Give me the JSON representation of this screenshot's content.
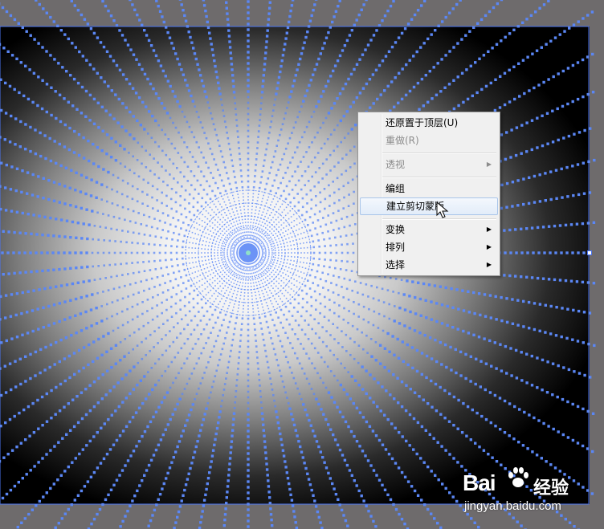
{
  "app": {
    "canvas_background": "#6e6b6c",
    "selection_color": "#4b74f0",
    "ray_color": "#5b87f5"
  },
  "context_menu": {
    "items": [
      {
        "label": "还原置于顶层(U)",
        "enabled": true,
        "submenu": false,
        "highlighted": false
      },
      {
        "label": "重做(R)",
        "enabled": false,
        "submenu": false,
        "highlighted": false
      },
      {
        "separator": true
      },
      {
        "label": "透视",
        "enabled": false,
        "submenu": true,
        "highlighted": false
      },
      {
        "separator": true
      },
      {
        "label": "编组",
        "enabled": true,
        "submenu": false,
        "highlighted": false
      },
      {
        "label": "建立剪切蒙版",
        "enabled": true,
        "submenu": false,
        "highlighted": true
      },
      {
        "separator": true
      },
      {
        "label": "变换",
        "enabled": true,
        "submenu": true,
        "highlighted": false
      },
      {
        "label": "排列",
        "enabled": true,
        "submenu": true,
        "highlighted": false
      },
      {
        "label": "选择",
        "enabled": true,
        "submenu": true,
        "highlighted": false
      }
    ],
    "submenu_arrow": "▶"
  },
  "watermark": {
    "logo_text": "Bai",
    "logo_icon": "paw-icon",
    "cn_text": "经验",
    "url": "jingyan.baidu.com"
  }
}
